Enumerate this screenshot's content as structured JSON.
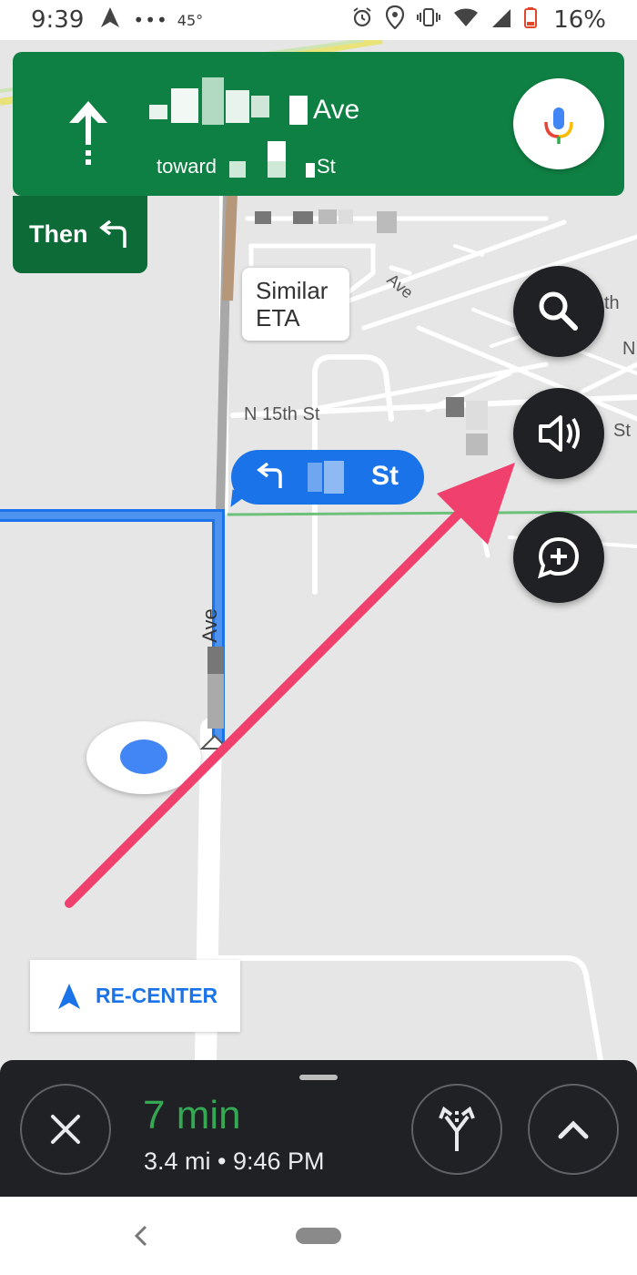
{
  "status_bar": {
    "time": "9:39",
    "dots": "•••",
    "temperature": "45°",
    "battery": "16%"
  },
  "navigation": {
    "street": "Ave",
    "toward_label": "toward",
    "toward_suffix": "St",
    "then_label": "Then"
  },
  "map": {
    "similar_eta": [
      "Similar",
      "ETA"
    ],
    "turn_bubble_suffix": "St",
    "labels": {
      "n15th": "N 15th St",
      "ave_top": "Ave",
      "ave_vertical": "Ave",
      "right_th": "th",
      "right_n": "N",
      "right_st": "St"
    }
  },
  "recenter": {
    "label": "RE-CENTER"
  },
  "trip": {
    "eta": "7 min",
    "details": "3.4 mi  •  9:46 PM"
  },
  "colors": {
    "nav_green": "#0f8043",
    "then_green": "#0c6b37",
    "route_blue": "#1a73e8",
    "eta_green": "#34a853",
    "arrow_pink": "#f0406e"
  },
  "icons": [
    "navigation-arrow-icon",
    "alarm-icon",
    "location-icon",
    "vibrate-icon",
    "wifi-icon",
    "battery-icon",
    "straight-arrow-icon",
    "mic-icon",
    "turn-left-icon",
    "search-icon",
    "volume-icon",
    "add-comment-icon",
    "close-icon",
    "alternate-routes-icon",
    "chevron-up-icon",
    "back-icon"
  ]
}
